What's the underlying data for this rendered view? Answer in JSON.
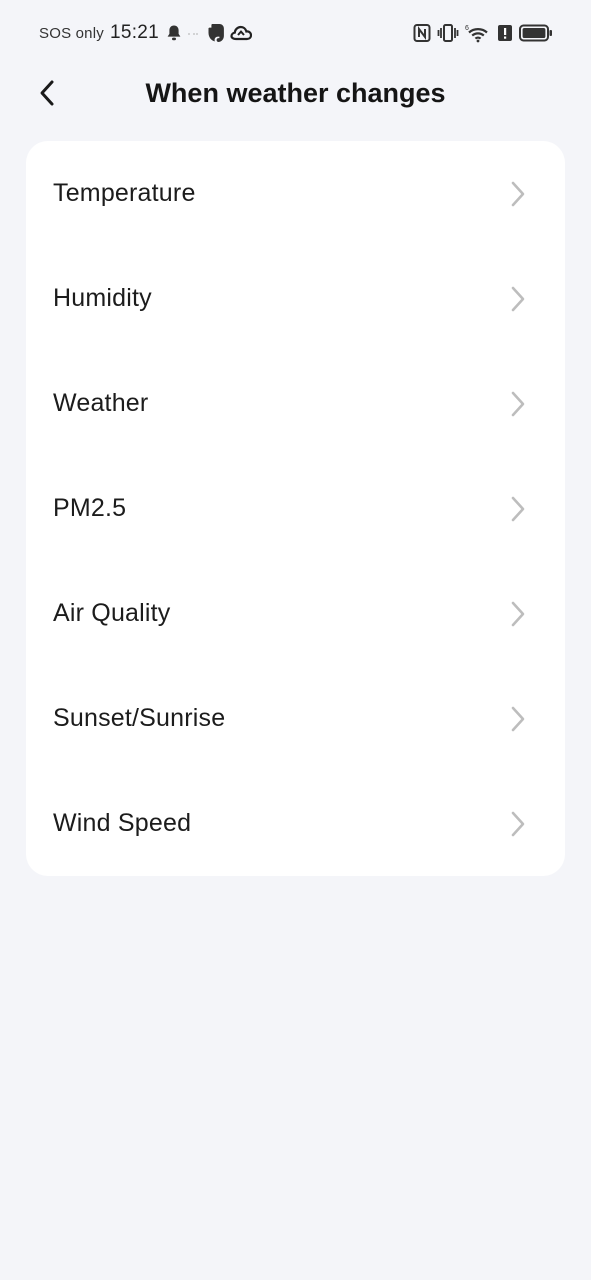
{
  "status_bar": {
    "carrier": "SOS only",
    "time": "15:21",
    "icons_left": [
      "bell-icon",
      "evernote-icon",
      "cloud-icon"
    ],
    "icons_right": [
      "nfc-icon",
      "vibrate-icon",
      "wifi-icon",
      "alert-icon",
      "battery-icon"
    ]
  },
  "header": {
    "back_icon": "chevron-left-icon",
    "title": "When weather changes"
  },
  "conditions": {
    "items": [
      {
        "label": "Temperature",
        "icon": "chevron-right-icon"
      },
      {
        "label": "Humidity",
        "icon": "chevron-right-icon"
      },
      {
        "label": "Weather",
        "icon": "chevron-right-icon"
      },
      {
        "label": "PM2.5",
        "icon": "chevron-right-icon"
      },
      {
        "label": "Air Quality",
        "icon": "chevron-right-icon"
      },
      {
        "label": "Sunset/Sunrise",
        "icon": "chevron-right-icon"
      },
      {
        "label": "Wind Speed",
        "icon": "chevron-right-icon"
      }
    ]
  },
  "colors": {
    "background": "#f4f5f9",
    "card": "#ffffff",
    "chevron": "#bdbdbd",
    "text": "#1c1c1c"
  }
}
